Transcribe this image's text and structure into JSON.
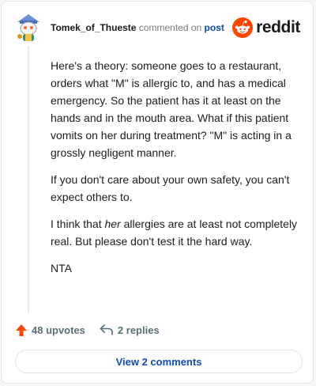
{
  "header": {
    "username": "Tomek_of_Thueste",
    "verb": "commented on",
    "post_link": "post",
    "logo_text": "reddit",
    "avatar_icon": "snoo-avatar-icon",
    "logo_icon": "reddit-alien-icon"
  },
  "comment": {
    "paragraphs": [
      {
        "text": "Here's a theory: someone goes to a restaurant, orders what \"M\" is allergic to, and has a medical emergency. So the patient has it at least on the hands and in the mouth area. What if this patient vomits on her during treatment? \"M\" is acting in a grossly negligent manner."
      },
      {
        "text": "If you don't care about your own safety, you can't expect others to."
      },
      {
        "before": "I think that ",
        "italic": "her",
        "after": " allergies are at least not completely real. But please don't test it the hard way."
      },
      {
        "text": "NTA"
      }
    ]
  },
  "actions": {
    "upvotes": "48 upvotes",
    "replies": "2 replies",
    "upvote_icon": "upvote-arrow-icon",
    "reply_icon": "reply-arrow-icon"
  },
  "footer": {
    "view_comments": "View 2 comments"
  },
  "colors": {
    "accent": "#ff4500",
    "link": "#0f4bb8",
    "text": "#1c1c1c",
    "muted": "#576f76"
  }
}
